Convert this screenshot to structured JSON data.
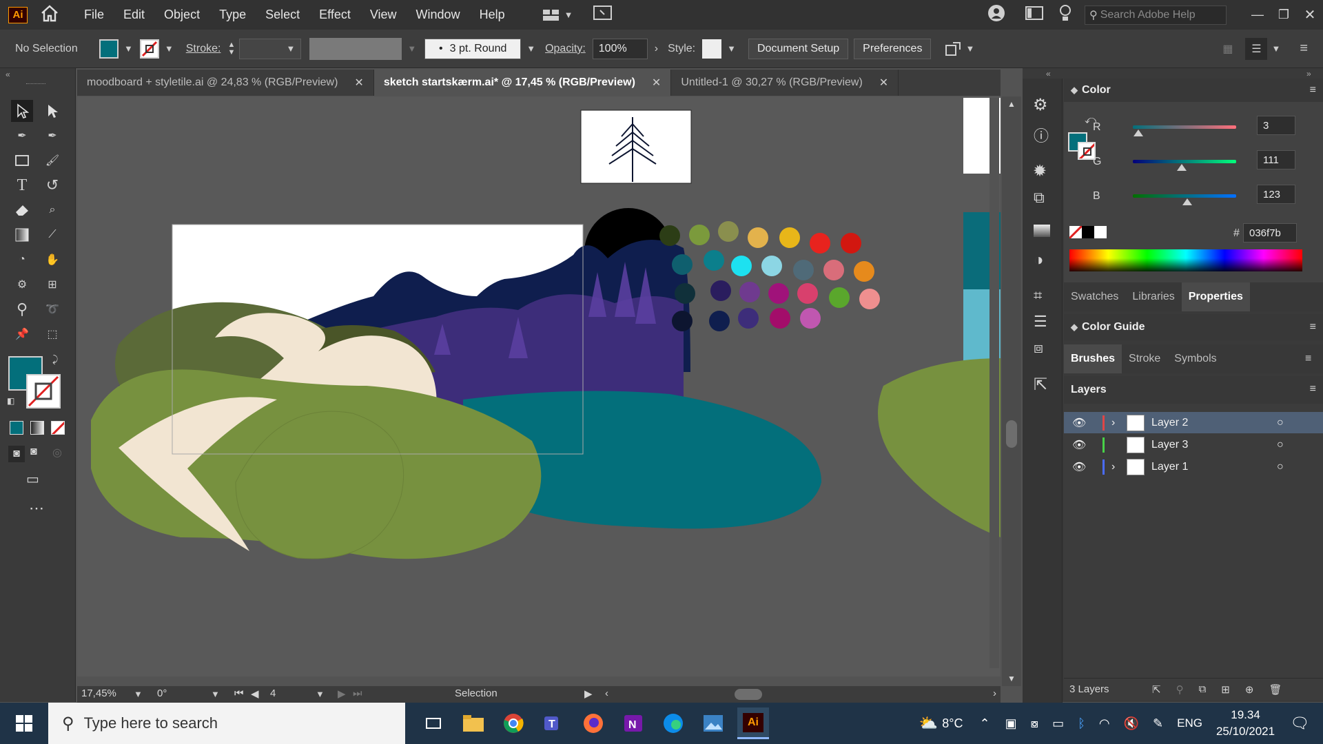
{
  "app": {
    "logo_text": "Ai"
  },
  "menu": [
    "File",
    "Edit",
    "Object",
    "Type",
    "Select",
    "Effect",
    "View",
    "Window",
    "Help"
  ],
  "search_placeholder": "Search Adobe Help",
  "control": {
    "selection": "No Selection",
    "stroke_label": "Stroke:",
    "brush_value": "3 pt. Round",
    "opacity_label": "Opacity:",
    "opacity_value": "100%",
    "style_label": "Style:",
    "document_setup": "Document Setup",
    "preferences": "Preferences"
  },
  "tabs": [
    {
      "label": "moodboard + styletile.ai @ 24,83 % (RGB/Preview)",
      "active": false
    },
    {
      "label": "sketch startskærm.ai* @ 17,45 % (RGB/Preview)",
      "active": true
    },
    {
      "label": "Untitled-1 @ 30,27 % (RGB/Preview)",
      "active": false
    }
  ],
  "color_panel": {
    "title": "Color",
    "r_label": "R",
    "r_value": "3",
    "g_label": "G",
    "g_value": "111",
    "b_label": "B",
    "b_value": "123",
    "hex_label": "#",
    "hex_value": "036f7b",
    "fill_color": "#036f7b"
  },
  "panel_tabs": [
    "Swatches",
    "Libraries",
    "Properties"
  ],
  "color_guide": "Color Guide",
  "brush_tabs": [
    "Brushes",
    "Stroke",
    "Symbols"
  ],
  "layers_panel": {
    "title": "Layers",
    "layers": [
      {
        "name": "Layer 2",
        "color": "#e04646",
        "selected": true,
        "expandable": true
      },
      {
        "name": "Layer 3",
        "color": "#48d148",
        "selected": false,
        "expandable": false
      },
      {
        "name": "Layer 1",
        "color": "#4a6cff",
        "selected": false,
        "expandable": true
      }
    ],
    "count": "3 Layers"
  },
  "status": {
    "zoom": "17,45%",
    "rotation": "0°",
    "artboard": "4",
    "tool": "Selection"
  },
  "swatch_colors": [
    "#2c3d16",
    "#7b9a3c",
    "#8a8f4e",
    "#e3b24c",
    "#e8b619",
    "#e8231e",
    "#d21710",
    "#0f5f6e",
    "#0b7f8c",
    "#1de1f0",
    "#8cd6e4",
    "#4f6a78",
    "#d96d7a",
    "#e68a1c",
    "#10303a",
    "#2a1d5e",
    "#6f3a8f",
    "#a0127a",
    "#d8406d",
    "#5aa72c",
    "#ef8f8f",
    "#0d1530",
    "#0f1e4e",
    "#3d2d7a",
    "#a30d6a",
    "#c057b0"
  ],
  "taskbar": {
    "search_placeholder": "Type here to search",
    "weather": "8°C",
    "lang": "ENG",
    "time": "19.34",
    "date": "25/10/2021"
  }
}
